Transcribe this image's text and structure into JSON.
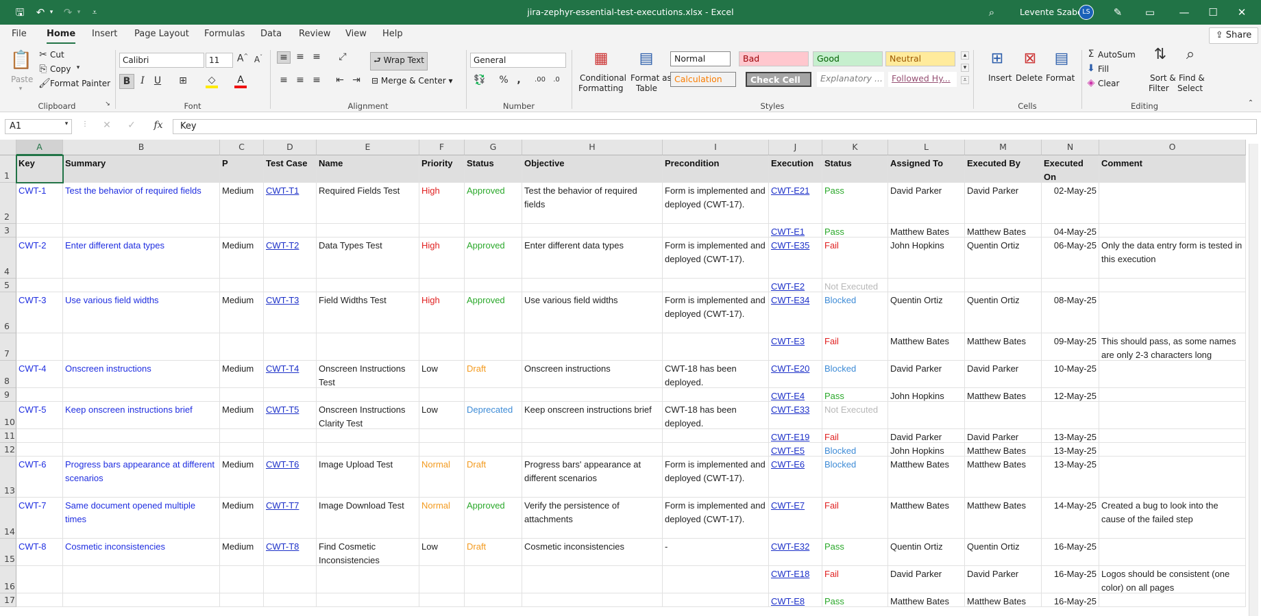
{
  "titlebar": {
    "title": "jira-zephyr-essential-test-executions.xlsx - Excel",
    "user": "Levente Szabo",
    "initials": "LS"
  },
  "menu": {
    "tabs": [
      "File",
      "Home",
      "Insert",
      "Page Layout",
      "Formulas",
      "Data",
      "Review",
      "View",
      "Help"
    ],
    "active": "Home",
    "share": "Share"
  },
  "ribbon": {
    "clipboard": {
      "label": "Clipboard",
      "paste": "Paste",
      "cut": "Cut",
      "copy": "Copy",
      "format_painter": "Format Painter"
    },
    "font": {
      "label": "Font",
      "name": "Calibri",
      "size": "11"
    },
    "alignment": {
      "label": "Alignment",
      "wrap": "Wrap Text",
      "merge": "Merge & Center"
    },
    "number": {
      "label": "Number",
      "format": "General"
    },
    "styles": {
      "label": "Styles",
      "conditional": "Conditional",
      "formatting": "Formatting",
      "format_as": "Format as",
      "table": "Table",
      "normal": "Normal",
      "bad": "Bad",
      "good": "Good",
      "neutral": "Neutral",
      "calculation": "Calculation",
      "check_cell": "Check Cell",
      "explanatory": "Explanatory ...",
      "followed": "Followed Hy..."
    },
    "cells": {
      "label": "Cells",
      "insert": "Insert",
      "delete": "Delete",
      "format": "Format"
    },
    "editing": {
      "label": "Editing",
      "autosum": "AutoSum",
      "fill": "Fill",
      "clear": "Clear",
      "sort1": "Sort &",
      "sort2": "Filter",
      "find1": "Find &",
      "find2": "Select"
    }
  },
  "formula": {
    "namebox": "A1",
    "content": "Key"
  },
  "columns": [
    "A",
    "B",
    "C",
    "D",
    "E",
    "F",
    "G",
    "H",
    "I",
    "J",
    "K",
    "L",
    "M",
    "N",
    "O"
  ],
  "headers": [
    "Key",
    "Summary",
    "P",
    "Test Case",
    "Name",
    "Priority",
    "Status",
    "Objective",
    "Precondition",
    "Execution",
    "Status",
    "Assigned To",
    "Executed By",
    "Executed On",
    "Comment"
  ],
  "rows": [
    {
      "n": "2",
      "h": 60,
      "c": [
        "CWT-1",
        "Test the behavior of required fields",
        "Medium",
        "CWT-T1",
        "Required Fields Test",
        "High",
        "Approved",
        "Test the behavior of required fields",
        "Form is implemented and deployed (CWT-17).",
        "CWT-E21",
        "Pass",
        "David Parker",
        "David Parker",
        "02-May-25",
        ""
      ]
    },
    {
      "n": "3",
      "h": 20,
      "c": [
        "",
        "",
        "",
        "",
        "",
        "",
        "",
        "",
        "",
        "CWT-E1",
        "Pass",
        "Matthew Bates",
        "Matthew Bates",
        "04-May-25",
        ""
      ]
    },
    {
      "n": "4",
      "h": 60,
      "c": [
        "CWT-2",
        "Enter different data types",
        "Medium",
        "CWT-T2",
        "Data Types Test",
        "High",
        "Approved",
        "Enter different data types",
        "Form is implemented and deployed (CWT-17).",
        "CWT-E35",
        "Fail",
        "John Hopkins",
        "Quentin Ortiz",
        "06-May-25",
        "Only the data entry form is tested in this execution"
      ]
    },
    {
      "n": "5",
      "h": 20,
      "c": [
        "",
        "",
        "",
        "",
        "",
        "",
        "",
        "",
        "",
        "CWT-E2",
        "Not Executed",
        "",
        "",
        "",
        ""
      ]
    },
    {
      "n": "6",
      "h": 60,
      "c": [
        "CWT-3",
        "Use various field widths",
        "Medium",
        "CWT-T3",
        "Field Widths Test",
        "High",
        "Approved",
        "Use various field widths",
        "Form is implemented and deployed (CWT-17).",
        "CWT-E34",
        "Blocked",
        "Quentin Ortiz",
        "Quentin Ortiz",
        "08-May-25",
        ""
      ]
    },
    {
      "n": "7",
      "h": 40,
      "c": [
        "",
        "",
        "",
        "",
        "",
        "",
        "",
        "",
        "",
        "CWT-E3",
        "Fail",
        "Matthew Bates",
        "Matthew Bates",
        "09-May-25",
        "This should pass, as some names are only 2-3 characters long"
      ]
    },
    {
      "n": "8",
      "h": 40,
      "c": [
        "CWT-4",
        "Onscreen instructions",
        "Medium",
        "CWT-T4",
        "Onscreen Instructions Test",
        "Low",
        "Draft",
        "Onscreen instructions",
        "CWT-18 has been deployed.",
        "CWT-E20",
        "Blocked",
        "David Parker",
        "David Parker",
        "10-May-25",
        ""
      ]
    },
    {
      "n": "9",
      "h": 20,
      "c": [
        "",
        "",
        "",
        "",
        "",
        "",
        "",
        "",
        "",
        "CWT-E4",
        "Pass",
        "John Hopkins",
        "Matthew Bates",
        "12-May-25",
        ""
      ]
    },
    {
      "n": "10",
      "h": 40,
      "c": [
        "CWT-5",
        "Keep onscreen instructions brief",
        "Medium",
        "CWT-T5",
        "Onscreen Instructions Clarity Test",
        "Low",
        "Deprecated",
        "Keep onscreen instructions brief",
        "CWT-18 has been deployed.",
        "CWT-E33",
        "Not Executed",
        "",
        "",
        "",
        ""
      ]
    },
    {
      "n": "11",
      "h": 20,
      "c": [
        "",
        "",
        "",
        "",
        "",
        "",
        "",
        "",
        "",
        "CWT-E19",
        "Fail",
        "David Parker",
        "David Parker",
        "13-May-25",
        ""
      ]
    },
    {
      "n": "12",
      "h": 20,
      "c": [
        "",
        "",
        "",
        "",
        "",
        "",
        "",
        "",
        "",
        "CWT-E5",
        "Blocked",
        "John Hopkins",
        "Matthew Bates",
        "13-May-25",
        ""
      ]
    },
    {
      "n": "13",
      "h": 60,
      "c": [
        "CWT-6",
        "Progress bars appearance at different scenarios",
        "Medium",
        "CWT-T6",
        "Image Upload Test",
        "Normal",
        "Draft",
        "Progress bars' appearance at different scenarios",
        "Form is implemented and deployed (CWT-17).",
        "CWT-E6",
        "Blocked",
        "Matthew Bates",
        "Matthew Bates",
        "13-May-25",
        ""
      ]
    },
    {
      "n": "14",
      "h": 60,
      "c": [
        "CWT-7",
        "Same document opened multiple times",
        "Medium",
        "CWT-T7",
        "Image Download Test",
        "Normal",
        "Approved",
        "Verify the persistence of attachments",
        "Form is implemented and deployed (CWT-17).",
        "CWT-E7",
        "Fail",
        "Matthew Bates",
        "Matthew Bates",
        "14-May-25",
        "Created a bug to look into the cause of the failed step"
      ]
    },
    {
      "n": "15",
      "h": 40,
      "c": [
        "CWT-8",
        "Cosmetic inconsistencies",
        "Medium",
        "CWT-T8",
        "Find Cosmetic Inconsistencies",
        "Low",
        "Draft",
        "Cosmetic inconsistencies",
        "-",
        "CWT-E32",
        "Pass",
        "Quentin Ortiz",
        "Quentin Ortiz",
        "16-May-25",
        ""
      ]
    },
    {
      "n": "16",
      "h": 40,
      "c": [
        "",
        "",
        "",
        "",
        "",
        "",
        "",
        "",
        "",
        "CWT-E18",
        "Fail",
        "David Parker",
        "David Parker",
        "16-May-25",
        "Logos should be consistent (one color) on all pages"
      ]
    },
    {
      "n": "17",
      "h": 20,
      "c": [
        "",
        "",
        "",
        "",
        "",
        "",
        "",
        "",
        "",
        "CWT-E8",
        "Pass",
        "Matthew Bates",
        "Matthew Bates",
        "16-May-25",
        ""
      ]
    }
  ]
}
